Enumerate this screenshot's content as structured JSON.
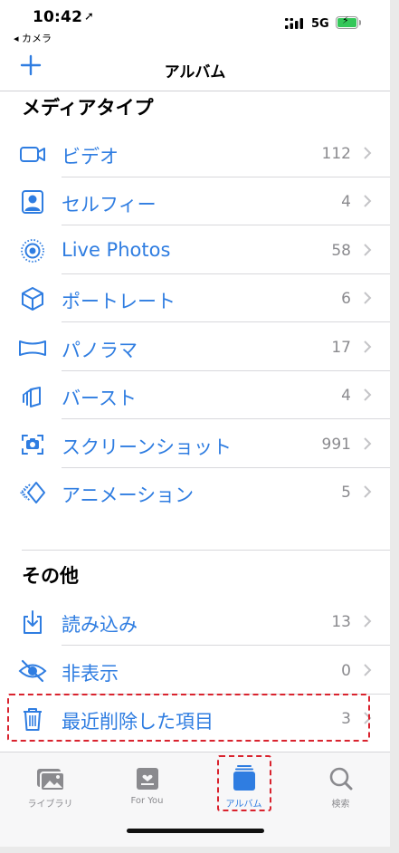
{
  "status_bar": {
    "time": "10:42",
    "location_arrow": "➚",
    "back_app": "◂ カメラ",
    "network": "5G"
  },
  "navbar": {
    "title": "アルバム",
    "add_icon": "plus-icon"
  },
  "sections": {
    "media_types": {
      "header": "メディアタイプ",
      "rows": [
        {
          "label": "ビデオ",
          "count": "112",
          "icon": "video-icon"
        },
        {
          "label": "セルフィー",
          "count": "4",
          "icon": "selfie-icon"
        },
        {
          "label": "Live Photos",
          "count": "58",
          "icon": "live-photos-icon"
        },
        {
          "label": "ポートレート",
          "count": "6",
          "icon": "portrait-icon"
        },
        {
          "label": "パノラマ",
          "count": "17",
          "icon": "panorama-icon"
        },
        {
          "label": "バースト",
          "count": "4",
          "icon": "burst-icon"
        },
        {
          "label": "スクリーンショット",
          "count": "991",
          "icon": "screenshot-icon"
        },
        {
          "label": "アニメーション",
          "count": "5",
          "icon": "animation-icon"
        }
      ]
    },
    "other": {
      "header": "その他",
      "rows": [
        {
          "label": "読み込み",
          "count": "13",
          "icon": "import-icon"
        },
        {
          "label": "非表示",
          "count": "0",
          "icon": "hidden-eye-icon"
        },
        {
          "label": "最近削除した項目",
          "count": "3",
          "icon": "trash-icon"
        }
      ]
    }
  },
  "tabbar": {
    "tabs": [
      {
        "label": "ライブラリ",
        "icon": "library-icon",
        "active": false
      },
      {
        "label": "For You",
        "icon": "for-you-icon",
        "active": false
      },
      {
        "label": "アルバム",
        "icon": "albums-icon",
        "active": true
      },
      {
        "label": "検索",
        "icon": "search-icon",
        "active": false
      }
    ]
  },
  "colors": {
    "accent": "#2f7de1",
    "secondary_text": "#8a8a8e",
    "highlight": "#d9232e"
  }
}
